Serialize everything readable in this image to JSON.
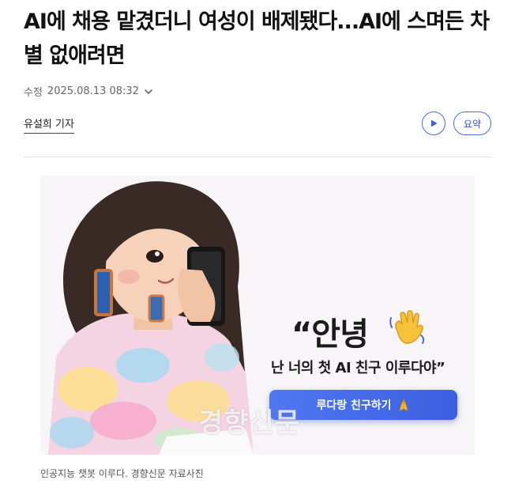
{
  "article": {
    "headline": "AI에 채용 맡겼더니 여성이 배제됐다...AI에 스며든 차별 없애려면",
    "modified_label": "수정",
    "modified_time": "2025.08.13 08:32",
    "reporter": "유설희 기자",
    "summary_label": "요약"
  },
  "figure": {
    "quote": "“안녕",
    "tagline": "난 너의 첫 AI 친구 이루다야”",
    "cta_label": "루다랑 친구하기",
    "watermark": "경향신문",
    "caption": "인공지능 챗봇 이루다. 경향신문 자료사진"
  },
  "icons": {
    "chevron": "chevron-down-icon",
    "play": "play-icon",
    "wave": "waving-hand-icon",
    "cta": "folded-hands-icon"
  },
  "colors": {
    "accent": "#3b5fe0",
    "button_outline": "#4a6bd8"
  }
}
